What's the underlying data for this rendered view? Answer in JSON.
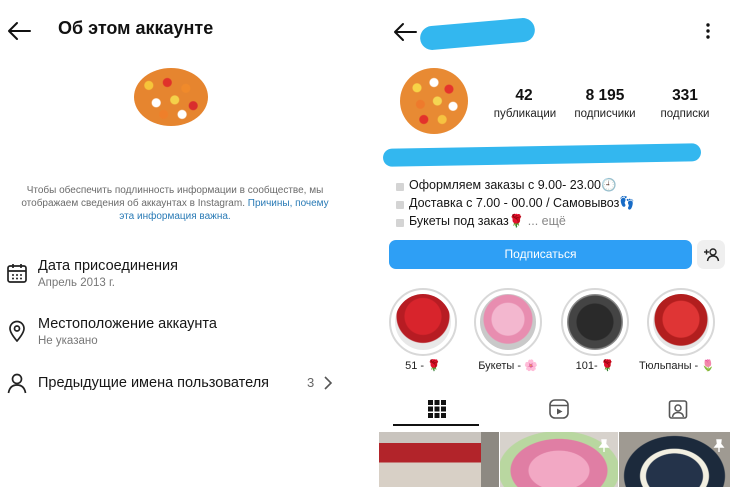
{
  "about": {
    "title": "Об этом аккаунте",
    "note": "Чтобы обеспечить подлинность информации в сообществе, мы отображаем сведения об аккаунтах в Instagram.",
    "note_link": "Причины, почему эта информация важна.",
    "rows": [
      {
        "icon": "calendar-icon",
        "label": "Дата присоединения",
        "value": "Апрель 2013 г."
      },
      {
        "icon": "location-pin-icon",
        "label": "Местоположение аккаунта",
        "value": "Не указано"
      },
      {
        "icon": "person-icon",
        "label": "Предыдущие имена пользователя",
        "count": "3"
      }
    ]
  },
  "profile": {
    "stats": [
      {
        "value": "42",
        "label": "публикации"
      },
      {
        "value": "8 195",
        "label": "подписчики"
      },
      {
        "value": "331",
        "label": "подписки"
      }
    ],
    "bio": [
      "Оформляем заказы с 9.00- 23.00🕘",
      "Доставка с 7.00 - 00.00 / Самовывоз👣",
      "Букеты под заказ🌹",
      "... ещё"
    ],
    "follow_label": "Подписаться",
    "highlights": [
      {
        "label": "51 - 🌹"
      },
      {
        "label": "Букеты - 🌸"
      },
      {
        "label": "101- 🌹"
      },
      {
        "label": "Тюльпаны - 🌷"
      }
    ],
    "tabs": [
      "grid-icon",
      "reels-icon",
      "tagged-icon"
    ]
  },
  "colors": {
    "accent": "#2e9ff5",
    "scribble": "#33b7ef",
    "link": "#2a7bb6"
  }
}
